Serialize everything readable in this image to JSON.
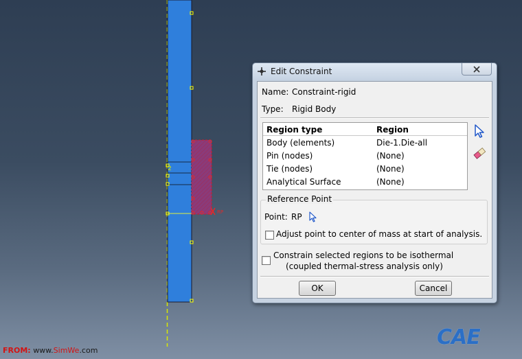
{
  "dialog": {
    "title": "Edit Constraint",
    "name_label": "Name:",
    "name_value": "Constraint-rigid",
    "type_label": "Type:",
    "type_value": "Rigid Body",
    "region_table": {
      "headers": [
        "Region type",
        "Region"
      ],
      "rows": [
        {
          "type": "Body (elements)",
          "region": "Die-1.Die-all"
        },
        {
          "type": "Pin (nodes)",
          "region": "(None)"
        },
        {
          "type": "Tie (nodes)",
          "region": "(None)"
        },
        {
          "type": "Analytical Surface",
          "region": "(None)"
        }
      ]
    },
    "reference_point": {
      "group_title": "Reference Point",
      "point_label": "Point:",
      "point_value": "RP",
      "adjust_label": "Adjust point to center of mass at start of analysis.",
      "adjust_checked": false
    },
    "isothermal": {
      "line1": "Constrain selected regions to be isothermal",
      "line2": "(coupled thermal-stress analysis only)",
      "checked": false
    },
    "ok_label": "OK",
    "cancel_label": "Cancel",
    "icons": {
      "title": "crosshair-icon",
      "close": "close-icon",
      "select": "select-arrow-icon",
      "erase": "eraser-icon",
      "rp_select": "select-arrow-icon"
    }
  },
  "viewport": {
    "axis_label": "2",
    "rp_marker": "RP"
  },
  "watermark": {
    "from": "FROM:",
    "site_prefix": "www.",
    "site_highlight": "SimWe",
    "site_suffix": ".com"
  },
  "logo": {
    "text": "CAE",
    "suffix": "",
    "colors": {
      "brand": "#2b6fc6"
    }
  },
  "colors": {
    "part_fill": "#2f7fdc",
    "selection": "#c0182a",
    "node_marker": "#ffff00",
    "axis_line": "#d8e800"
  }
}
